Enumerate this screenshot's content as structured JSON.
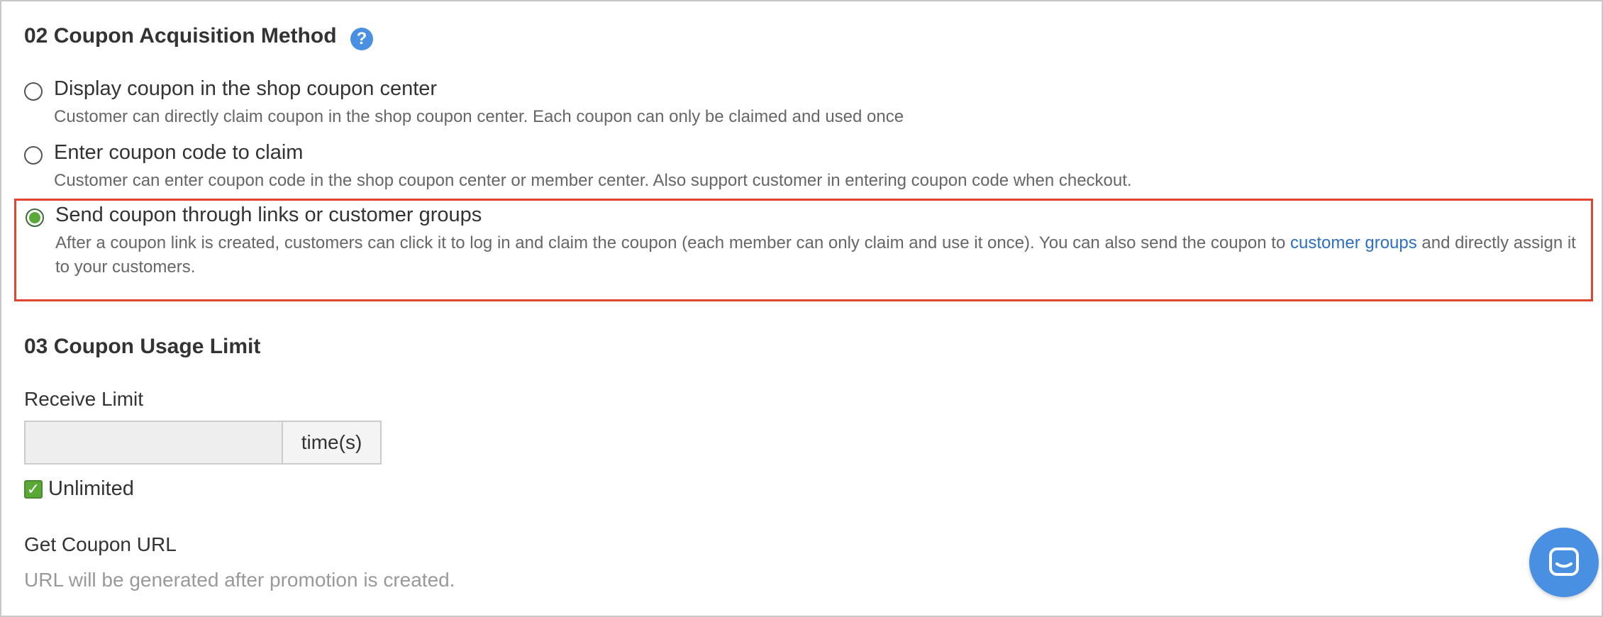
{
  "section_02": {
    "title": "02 Coupon Acquisition Method",
    "help_icon": "question-icon",
    "options": [
      {
        "label": "Display coupon in the shop coupon center",
        "description": "Customer can directly claim coupon in the shop coupon center. Each coupon can only be claimed and used once",
        "selected": false
      },
      {
        "label": "Enter coupon code to claim",
        "description": "Customer can enter coupon code in the shop coupon center or member center. Also support customer in entering coupon code when checkout.",
        "selected": false
      },
      {
        "label": "Send coupon through links or customer groups",
        "description_before": "After a coupon link is created, customers can click it to log in and claim the coupon (each member can only claim and use it once). You can also send the coupon to ",
        "description_link": "customer groups",
        "description_after": " and directly assign it to your customers.",
        "selected": true
      }
    ]
  },
  "section_03": {
    "title": "03 Coupon Usage Limit",
    "receive_limit_label": "Receive Limit",
    "receive_limit_value": "",
    "receive_limit_addon": "time(s)",
    "unlimited_label": "Unlimited",
    "unlimited_checked": true,
    "get_url_label": "Get Coupon URL",
    "get_url_note": "URL will be generated after promotion is created."
  },
  "chat_button_icon": "chat-icon",
  "colors": {
    "highlight_border": "#e0452f",
    "accent_green": "#5aa838",
    "link_blue": "#2d6fc0",
    "help_blue": "#4a90e2"
  }
}
